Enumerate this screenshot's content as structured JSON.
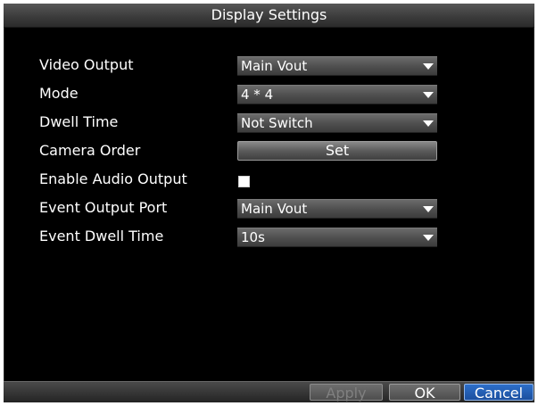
{
  "dialog": {
    "title": "Display Settings",
    "rows": [
      {
        "label": "Video Output",
        "value": "Main Vout"
      },
      {
        "label": "Mode",
        "value": "4 * 4"
      },
      {
        "label": "Dwell Time",
        "value": "Not Switch"
      },
      {
        "label": "Camera Order",
        "button": "Set"
      },
      {
        "label": "Enable Audio Output",
        "checked": false
      },
      {
        "label": "Event Output Port",
        "value": "Main Vout"
      },
      {
        "label": "Event Dwell Time",
        "value": "10s"
      }
    ],
    "buttons": {
      "apply": "Apply",
      "ok": "OK",
      "cancel": "Cancel"
    }
  },
  "colors": {
    "background": "#000000",
    "title_bar": "#4a4a4a",
    "cancel_highlight": "#2d6fc9",
    "disabled_text": "#808080"
  },
  "icons": {
    "dropdown": "chevron-down-icon",
    "checkbox": "checkbox-icon"
  }
}
